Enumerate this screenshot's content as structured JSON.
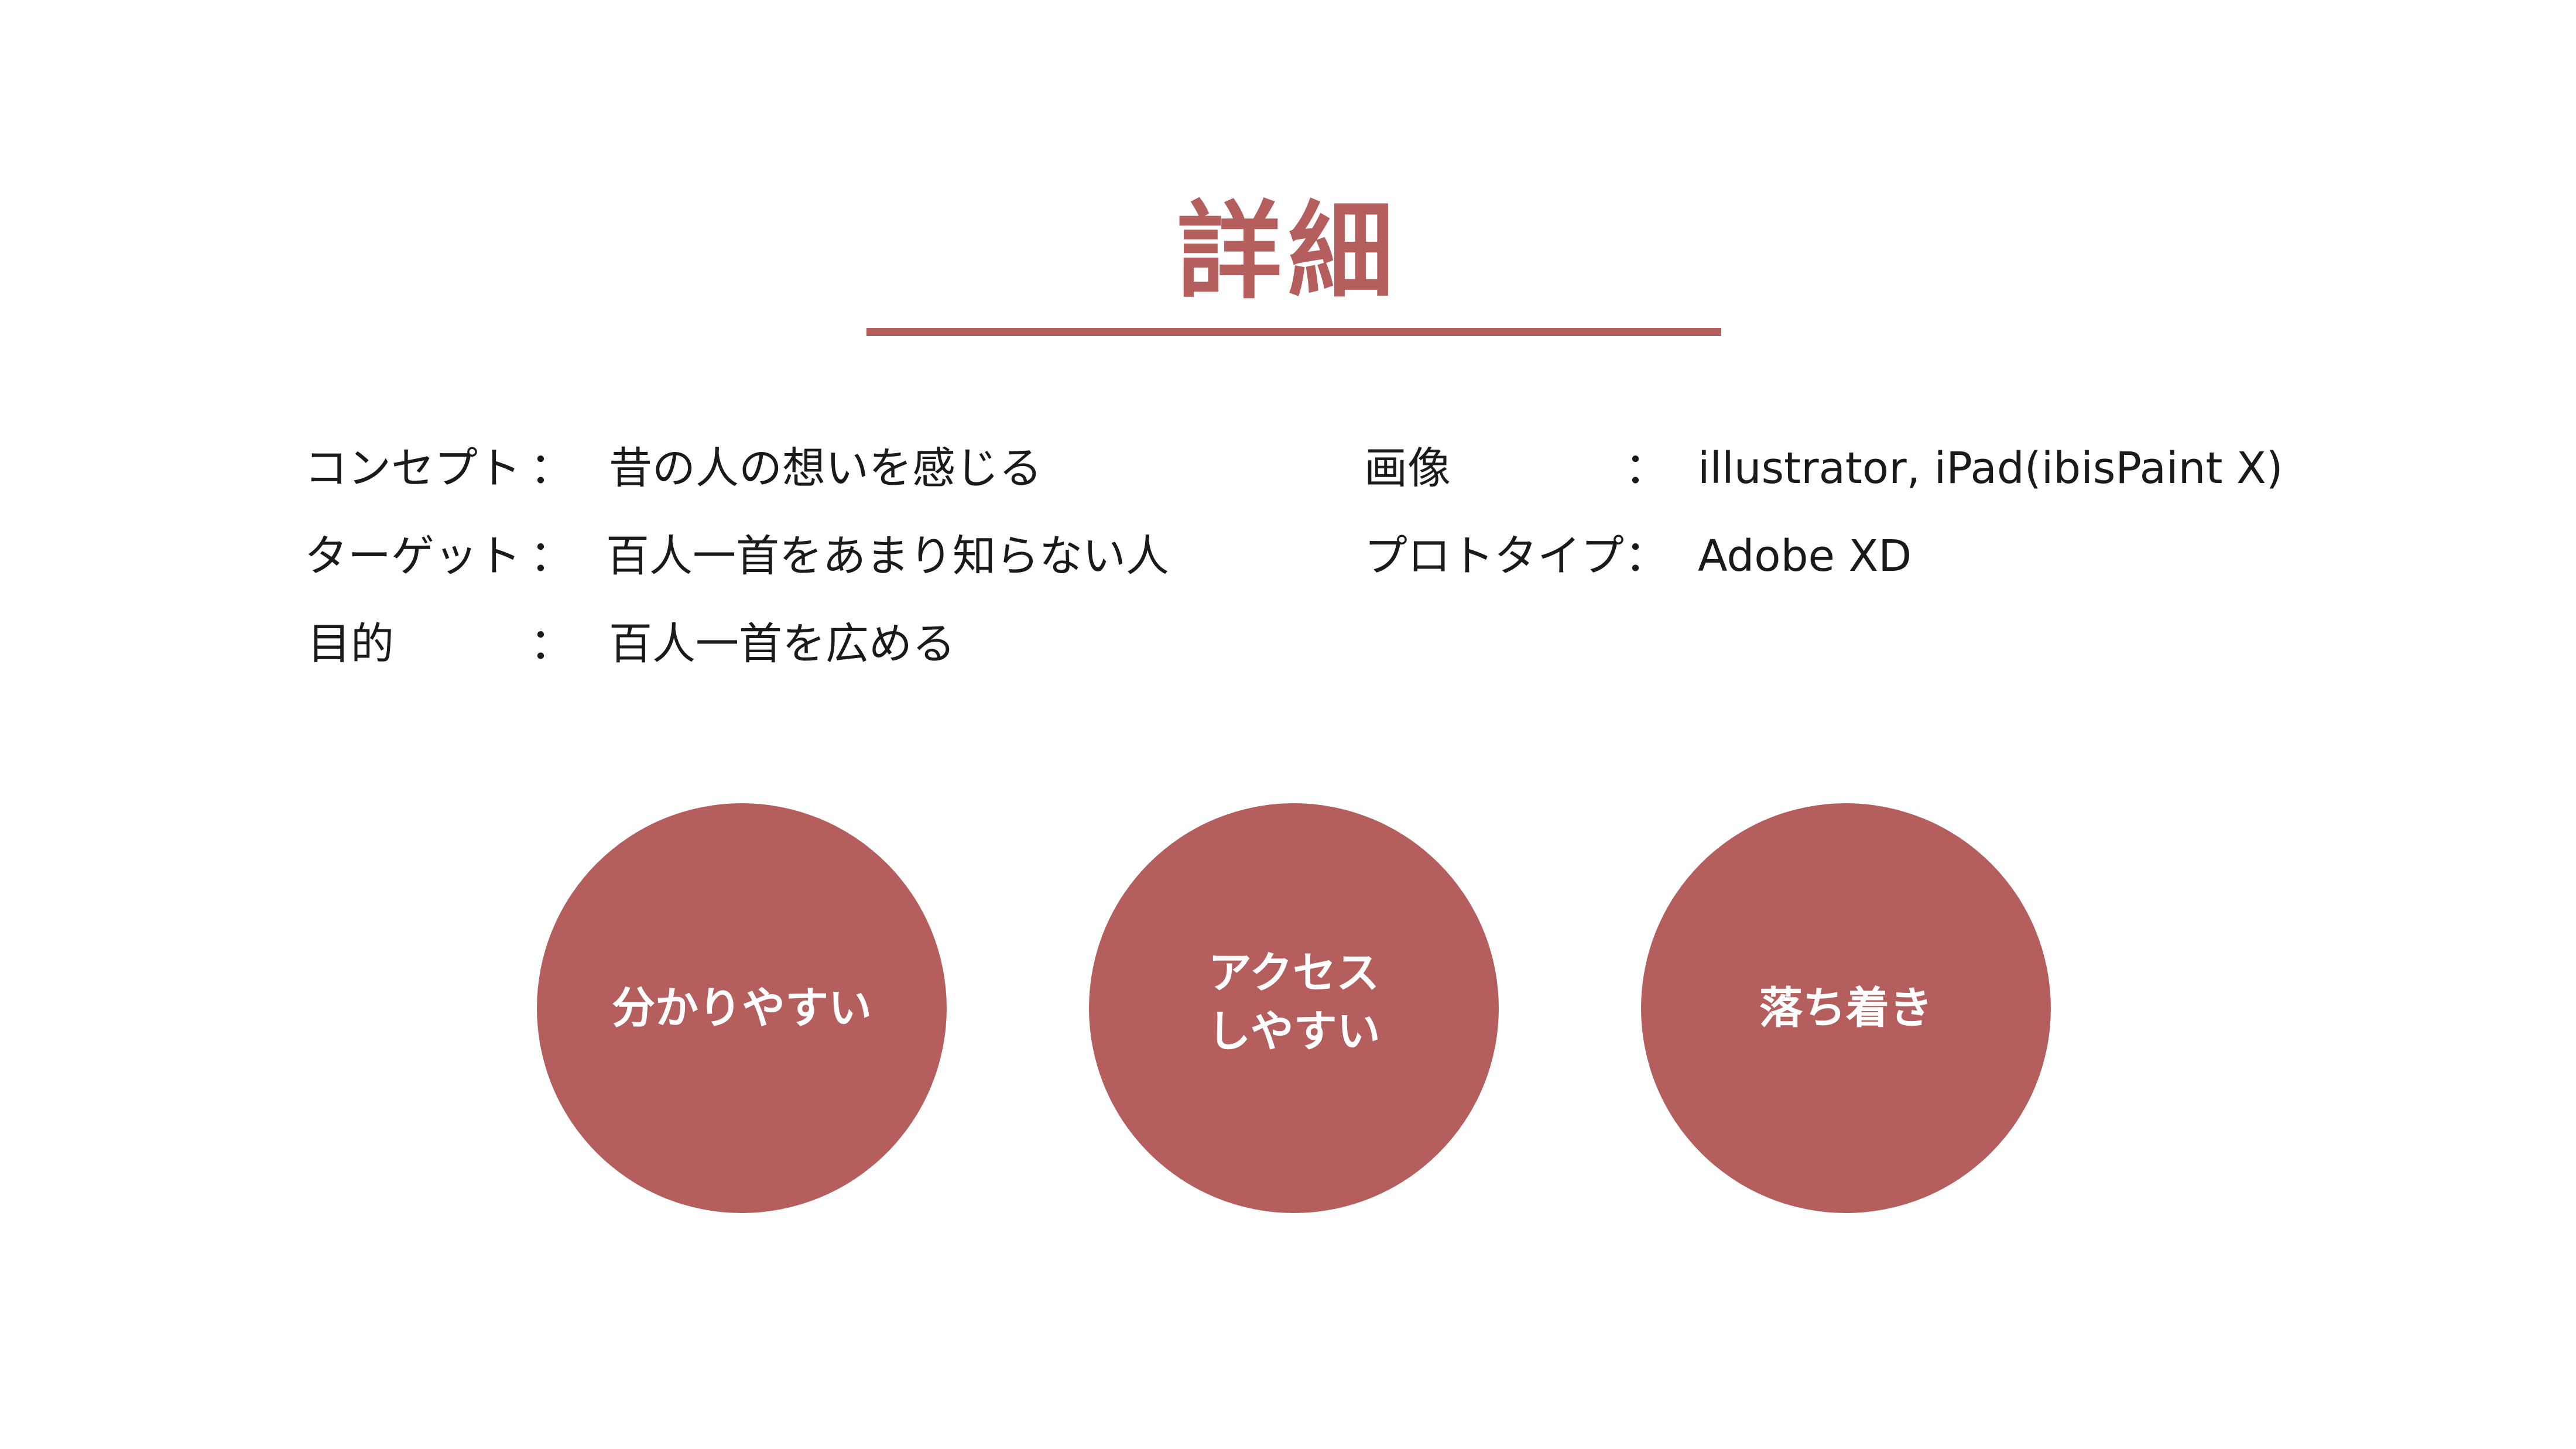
{
  "title": "詳細",
  "info_left": [
    {
      "label": "コンセプト",
      "colon": "：",
      "value": "昔の人の想いを感じる"
    },
    {
      "label": "ターゲット",
      "colon": "：",
      "value": "百人一首をあまり知らない人"
    },
    {
      "label": "目的",
      "colon": "：",
      "value": "百人一首を広める"
    }
  ],
  "info_right": [
    {
      "label": "画像",
      "colon": "：",
      "value": "illustrator, iPad(ibisPaint X)"
    },
    {
      "label": "プロトタイプ",
      "colon": "：",
      "value": "Adobe XD"
    }
  ],
  "circles": [
    {
      "lines": [
        "分かりやすい"
      ]
    },
    {
      "lines": [
        "アクセス",
        "しやすい"
      ]
    },
    {
      "lines": [
        "落ち着き"
      ]
    }
  ],
  "colors": {
    "accent": "#b45f5e",
    "text": "#1a1a1a",
    "background": "#ffffff",
    "circle_text": "#ffffff"
  }
}
